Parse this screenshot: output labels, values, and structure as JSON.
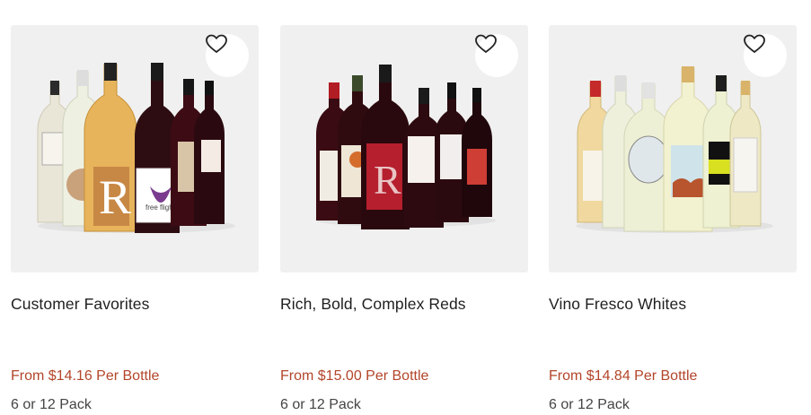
{
  "products": [
    {
      "title": "Customer Favorites",
      "price": "From $14.16 Per Bottle",
      "pack": "6 or 12 Pack",
      "image_alt": "Customer Favorites wine bottles",
      "label_text": "free flight"
    },
    {
      "title": "Rich, Bold, Complex Reds",
      "price": "From $15.00 Per Bottle",
      "pack": "6 or 12 Pack",
      "image_alt": "Rich, Bold, Complex Reds wine bottles"
    },
    {
      "title": "Vino Fresco Whites",
      "price": "From $14.84 Per Bottle",
      "pack": "6 or 12 Pack",
      "image_alt": "Vino Fresco Whites wine bottles"
    }
  ],
  "icons": {
    "favorite": "heart-outline-icon"
  },
  "colors": {
    "price": "#b3452a",
    "image_bg": "#f0f0f0"
  }
}
